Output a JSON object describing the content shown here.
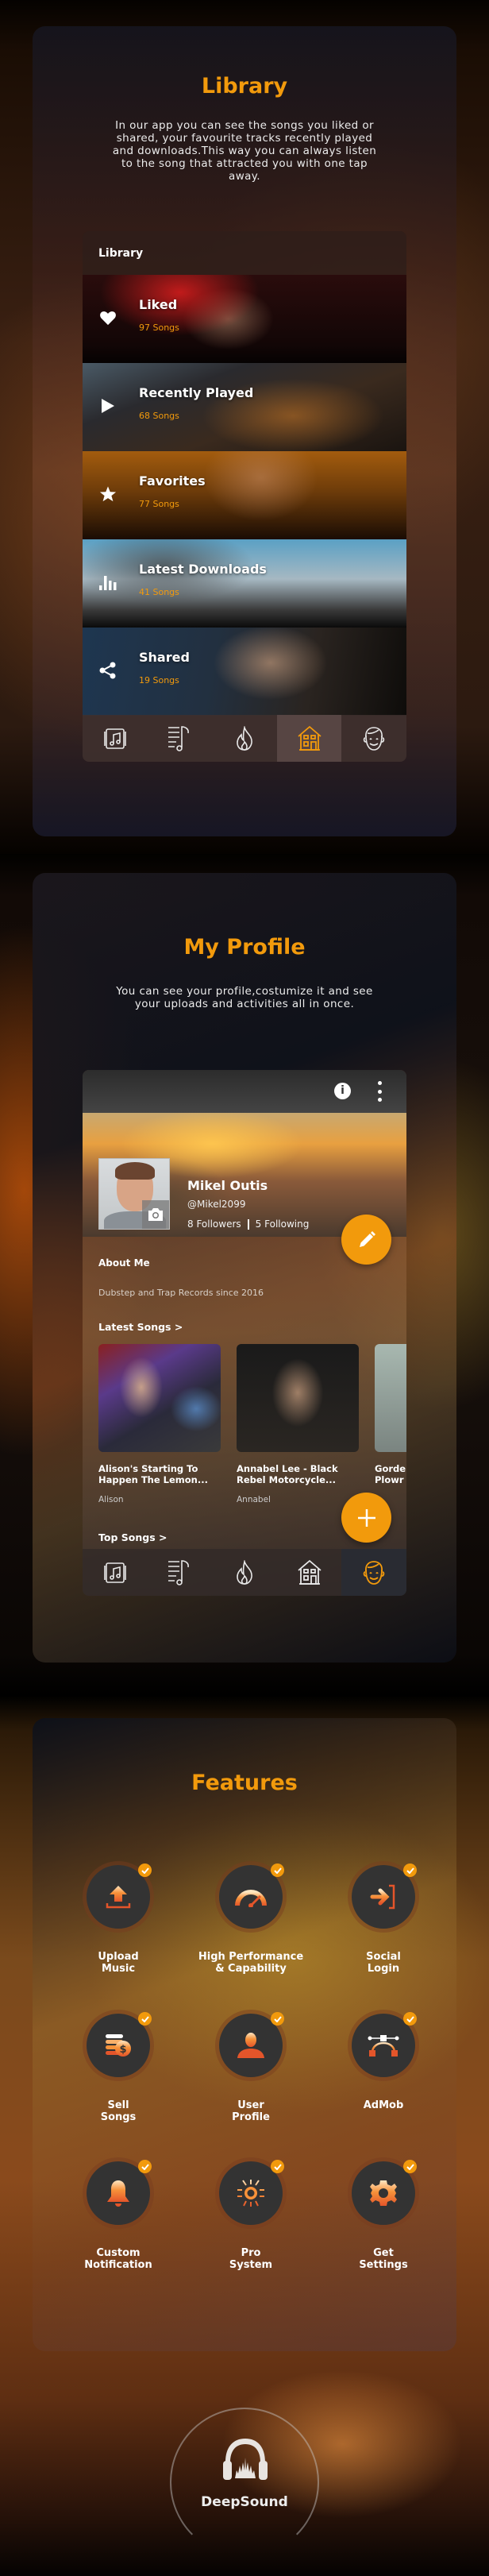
{
  "colors": {
    "accent": "#f29a0c",
    "feature_circle": "#333333",
    "text": "#ffffff"
  },
  "library_section": {
    "title": "Library",
    "description": "In our app you can see the songs you liked or shared, your favourite tracks recently played and downloads.This way you can always listen to the song that attracted you with one tap away.",
    "screen": {
      "header": "Library",
      "items": [
        {
          "icon": "heart-icon",
          "title": "Liked",
          "count": "97 Songs"
        },
        {
          "icon": "play-icon",
          "title": "Recently Played",
          "count": "68 Songs"
        },
        {
          "icon": "star-icon",
          "title": "Favorites",
          "count": "77 Songs"
        },
        {
          "icon": "bar-chart-icon",
          "title": "Latest Downloads",
          "count": "41 Songs"
        },
        {
          "icon": "share-icon",
          "title": "Shared",
          "count": "19 Songs"
        }
      ],
      "nav": [
        "album-icon",
        "playlist-icon",
        "trending-fire-icon",
        "home-icon",
        "profile-face-icon"
      ],
      "active_nav": "home-icon"
    }
  },
  "profile_section": {
    "title": "My Profile",
    "description": "You can see your profile,costumize it and see your uploads and activities all in once.",
    "screen": {
      "info_icon": "i",
      "name": "Mikel Outis",
      "handle": "@Mikel2099",
      "followers": "8 Followers",
      "following": "5 Following",
      "about_title": "About Me",
      "about_text": "Dubstep and Trap Records since 2016",
      "latest_title": "Latest Songs >",
      "songs": [
        {
          "title": "Alison's Starting To\nHappen The Lemon...",
          "artist": "Alison"
        },
        {
          "title": "Annabel Lee - Black\nRebel Motorcycle...",
          "artist": "Annabel"
        },
        {
          "title": "Gorde\nPlowr",
          "artist": ""
        }
      ],
      "top_title": "Top Songs >",
      "active_nav": "profile-face-icon"
    }
  },
  "features_section": {
    "title": "Features",
    "items": [
      {
        "icon": "upload-icon",
        "label": "Upload\nMusic"
      },
      {
        "icon": "speedometer-icon",
        "label": "High Performance\n& Capability"
      },
      {
        "icon": "login-icon",
        "label": "Social\nLogin"
      },
      {
        "icon": "coins-dollar-icon",
        "label": "Sell\nSongs"
      },
      {
        "icon": "user-icon",
        "label": "User\nProfile"
      },
      {
        "icon": "bezier-icon",
        "label": "AdMob"
      },
      {
        "icon": "bell-icon",
        "label": "Custom\nNotification"
      },
      {
        "icon": "gear-network-icon",
        "label": "Pro\nSystem"
      },
      {
        "icon": "settings-gear-icon",
        "label": "Get\nSettings"
      }
    ]
  },
  "brand": {
    "name": "DeepSound",
    "logo_icon": "headphones-icon"
  }
}
